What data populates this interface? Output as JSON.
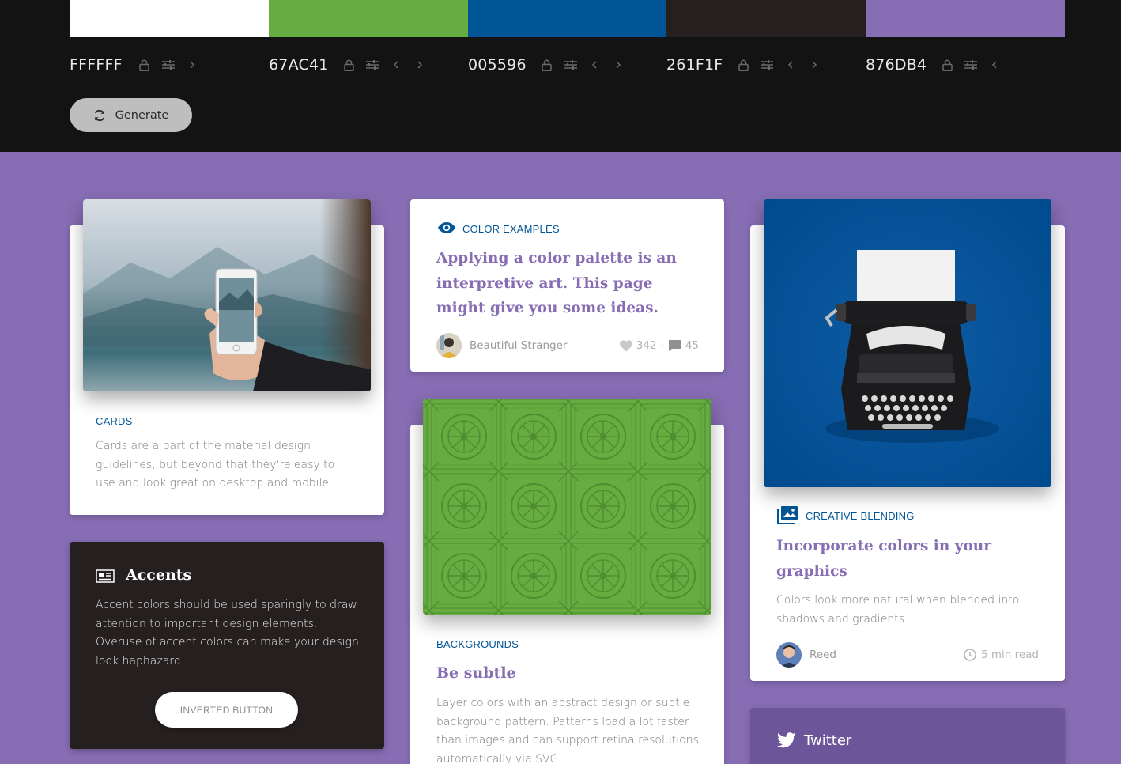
{
  "palette": {
    "colors": [
      {
        "hex": "FFFFFF",
        "color": "#FFFFFF",
        "has_prev": false,
        "has_next": true
      },
      {
        "hex": "67AC41",
        "color": "#67AC41",
        "has_prev": true,
        "has_next": true
      },
      {
        "hex": "005596",
        "color": "#005596",
        "has_prev": true,
        "has_next": true
      },
      {
        "hex": "261F1F",
        "color": "#261F1F",
        "has_prev": true,
        "has_next": true
      },
      {
        "hex": "876DB4",
        "color": "#876DB4",
        "has_prev": true,
        "has_next": false
      }
    ],
    "generate_label": "Generate"
  },
  "cards_card": {
    "eyebrow": "CARDS",
    "body": "Cards are a part of the material design guidelines, but beyond that they're easy to use and look great on desktop and mobile."
  },
  "accents_card": {
    "title": "Accents",
    "body": "Accent colors should be used sparingly to draw attention to important design elements. Overuse of accent colors can make your design look haphazard.",
    "button_label": "INVERTED BUTTON"
  },
  "color_examples_card": {
    "eyebrow": "COLOR EXAMPLES",
    "headline": "Applying a color palette is an interpretive art. This page might give you some ideas.",
    "author": "Beautiful Stranger",
    "likes": "342",
    "comments": "45"
  },
  "backgrounds_card": {
    "eyebrow": "BACKGROUNDS",
    "headline": "Be subtle",
    "body": "Layer colors with an abstract design or subtle background pattern. Patterns load a lot faster than images and can support retina resolutions automatically via SVG."
  },
  "creative_card": {
    "eyebrow": "CREATIVE BLENDING",
    "headline": "Incorporate colors in your graphics",
    "body": "Colors look more natural when blended into shadows and gradients",
    "author": "Reed",
    "read_time": "5 min read"
  },
  "twitter_card": {
    "title": "Twitter"
  },
  "colors": {
    "accent_purple": "#876DB4",
    "blue": "#005596",
    "green": "#67AC41",
    "dark": "#261F1F"
  }
}
